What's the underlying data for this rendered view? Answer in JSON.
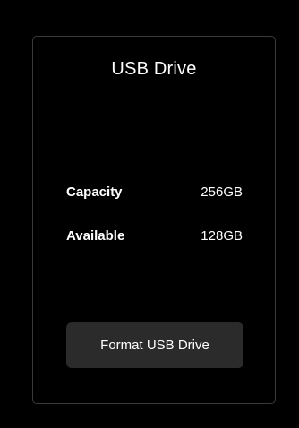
{
  "dialog": {
    "title": "USB Drive"
  },
  "info": {
    "capacity_label": "Capacity",
    "capacity_value": "256GB",
    "available_label": "Available",
    "available_value": "128GB"
  },
  "actions": {
    "format_label": "Format USB Drive"
  },
  "colors": {
    "background": "#000000",
    "border": "#3a3a3a",
    "button": "#2b2b2b",
    "text": "#ffffff"
  }
}
